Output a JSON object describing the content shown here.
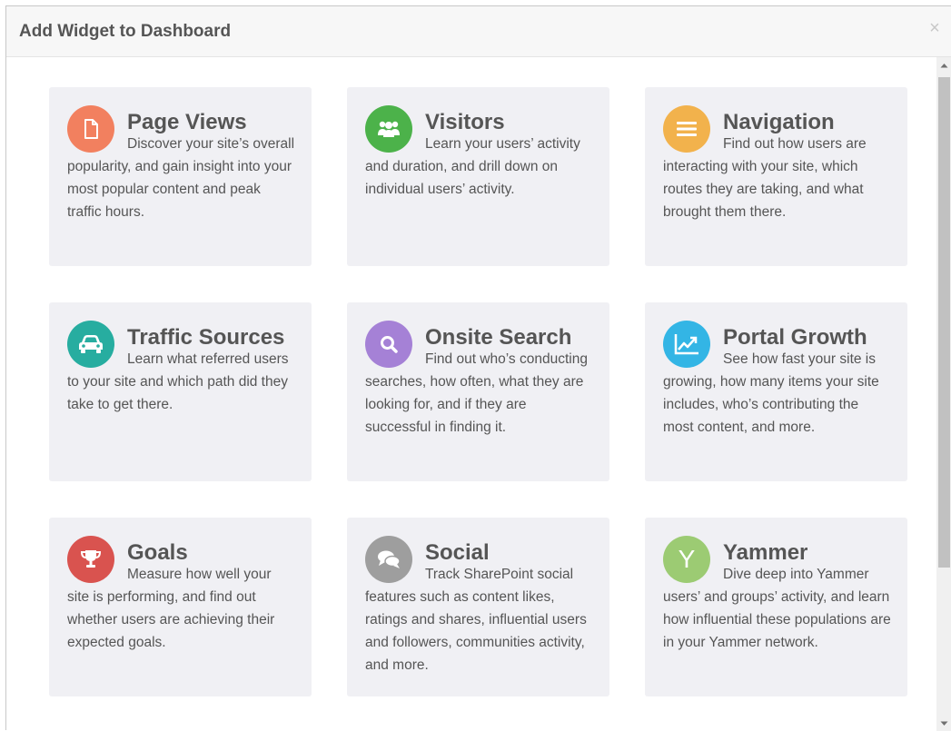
{
  "dialog": {
    "title": "Add Widget to Dashboard",
    "close_label": "×"
  },
  "widgets": [
    {
      "title": "Page Views",
      "description": "Discover your site’s overall popularity, and gain insight into your most popular content and peak traffic hours.",
      "icon": "document-icon",
      "color": "#f2805f"
    },
    {
      "title": "Visitors",
      "description": "Learn your users’ activity and duration, and drill down on individual users’ activity.",
      "icon": "users-icon",
      "color": "#4cb24a"
    },
    {
      "title": "Navigation",
      "description": "Find out how users are interacting with your site, which routes they are taking, and what brought them there.",
      "icon": "menu-icon",
      "color": "#f2b24c"
    },
    {
      "title": "Traffic Sources",
      "description": "Learn what referred users to your site and which path did they take to get there.",
      "icon": "car-icon",
      "color": "#27ada0"
    },
    {
      "title": "Onsite Search",
      "description": "Find out who’s conducting searches, how often, what they are looking for, and if they are successful in finding it.",
      "icon": "search-icon",
      "color": "#a581d6"
    },
    {
      "title": "Portal Growth",
      "description": "See how fast your site is growing, how many items your site includes, who’s contributing the most content, and more.",
      "icon": "growth-chart-icon",
      "color": "#33b5e5"
    },
    {
      "title": "Goals",
      "description": "Measure how well your site is performing, and find out whether users are achieving their expected goals.",
      "icon": "trophy-icon",
      "color": "#d9534f"
    },
    {
      "title": "Social",
      "description": "Track SharePoint social features such as content likes, ratings and shares, influential users and followers, communities activity, and more.",
      "icon": "chat-bubbles-icon",
      "color": "#9e9e9e"
    },
    {
      "title": "Yammer",
      "description": "Dive deep into Yammer users’ and groups’ activity, and learn how influential these populations are in your Yammer network.",
      "icon": "yammer-icon",
      "icon_text": "Y",
      "color": "#9ccb73"
    }
  ]
}
